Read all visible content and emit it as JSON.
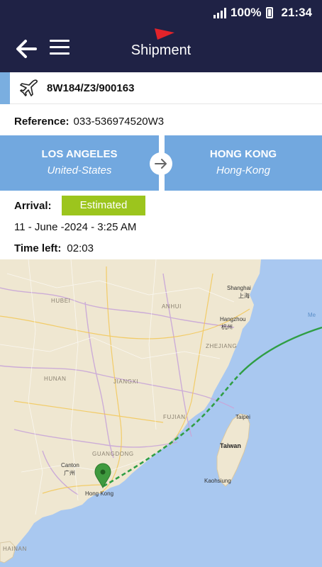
{
  "status_bar": {
    "battery": "100%",
    "time": "21:34"
  },
  "app_bar": {
    "title": "Shipment"
  },
  "shipment": {
    "flight_number": "8W184/Z3/900163",
    "reference_label": "Reference:",
    "reference_value": "033-536974520W3",
    "origin": {
      "city": "LOS ANGELES",
      "country": "United-States"
    },
    "destination": {
      "city": "HONG KONG",
      "country": "Hong-Kong"
    },
    "arrival_label": "Arrival:",
    "arrival_status": "Estimated",
    "arrival_datetime": "11 - June -2024 - 3:25 AM",
    "time_left_label": "Time left:",
    "time_left_value": "02:03"
  },
  "map": {
    "labels": {
      "hubei": "HUBEI",
      "anhui": "ANHUI",
      "shanghai": "Shanghai",
      "shanghai_cn": "上海",
      "hangzhou": "Hangzhou",
      "hangzhou_cn": "杭州",
      "zhejiang": "ZHEJIANG",
      "hunan": "HUNAN",
      "jiangxi": "JIANGXI",
      "fujian": "FUJIAN",
      "taipei": "Taipei",
      "taiwan": "Taiwan",
      "guangdong": "GUANGDONG",
      "canton": "Canton",
      "canton_cn": "广州",
      "hong_kong": "Hong Kong",
      "kaohsiung": "Kaohsiung",
      "hainan": "HAINAN",
      "sea": "Me"
    },
    "colors": {
      "land": "#efe7d1",
      "water": "#a9c8f0",
      "route": "#2f9e44",
      "marker": "#3f9a3f"
    }
  }
}
